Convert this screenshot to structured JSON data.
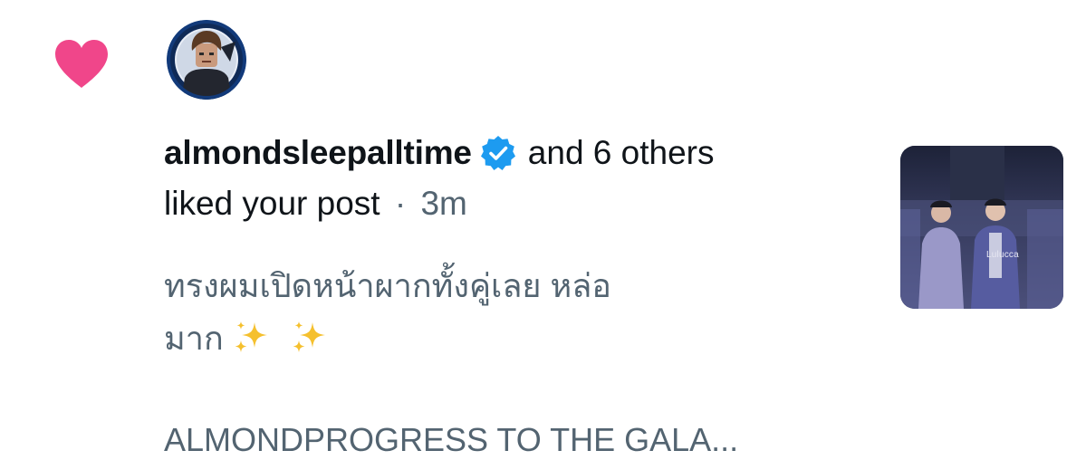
{
  "notification": {
    "username": "almondsleepalltime",
    "others_text": "and 6 others",
    "action_text": "liked your post",
    "separator": "·",
    "time": "3m",
    "post_text_line1": "ทรงผมเปิดหน้าผากทั้งคู่เลย หล่อ",
    "post_text_line2_prefix": "มาก",
    "post_teaser": "ALMONDPROGRESS TO THE GALA...",
    "thumbnail_watermark": "Lulucca",
    "icons": {
      "like": "heart-icon",
      "verified": "verified-badge-icon",
      "sparkle": "sparkles-icon"
    },
    "colors": {
      "like": "#f0468a",
      "verified": "#1d9bf0",
      "primary_text": "#0f1419",
      "secondary_text": "#536471",
      "sparkle": "#f5c02e"
    }
  }
}
